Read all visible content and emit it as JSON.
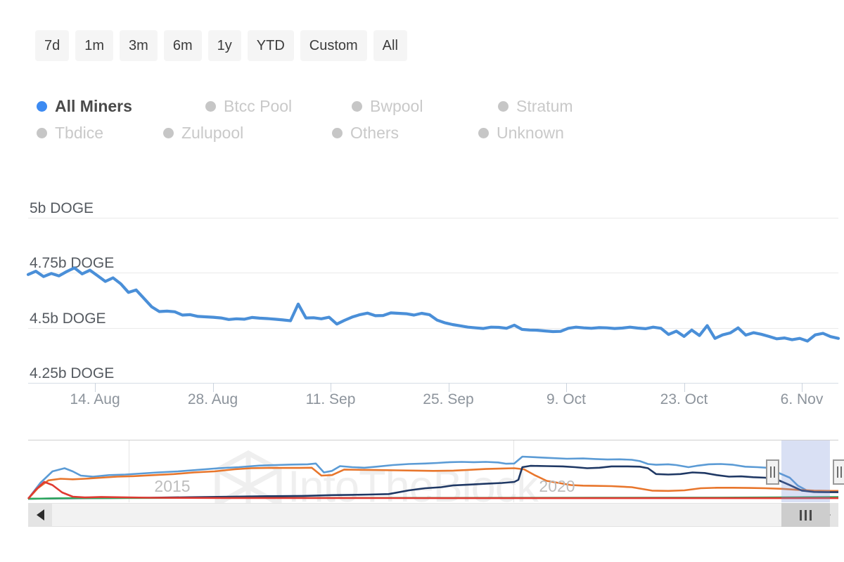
{
  "range_selector": {
    "buttons": [
      {
        "label": "7d",
        "selected": false
      },
      {
        "label": "1m",
        "selected": false
      },
      {
        "label": "3m",
        "selected": false
      },
      {
        "label": "6m",
        "selected": false
      },
      {
        "label": "1y",
        "selected": false
      },
      {
        "label": "YTD",
        "selected": false
      },
      {
        "label": "Custom",
        "selected": false
      },
      {
        "label": "All",
        "selected": false
      }
    ]
  },
  "legend": {
    "items": [
      {
        "label": "All Miners",
        "active": true,
        "color": "#3d8bf2"
      },
      {
        "label": "Btcc Pool",
        "active": false,
        "color": "#c6c6c6"
      },
      {
        "label": "Bwpool",
        "active": false,
        "color": "#c6c6c6"
      },
      {
        "label": "Stratum",
        "active": false,
        "color": "#c6c6c6"
      },
      {
        "label": "Tbdice",
        "active": false,
        "color": "#c6c6c6"
      },
      {
        "label": "Zulupool",
        "active": false,
        "color": "#c6c6c6"
      },
      {
        "label": "Others",
        "active": false,
        "color": "#c6c6c6"
      },
      {
        "label": "Unknown",
        "active": false,
        "color": "#c6c6c6"
      }
    ]
  },
  "watermark": {
    "text": "IntoTheBlock",
    "color": "#efefef"
  },
  "navigator": {
    "year_labels": [
      "2015",
      "2020"
    ],
    "selection_start_pct": 93.0,
    "selection_end_pct": 99.0,
    "series_colors": [
      "#5b9bd5",
      "#e8762c",
      "#1f3864",
      "#2eab5f",
      "#e03a32"
    ]
  },
  "scrollbar": {
    "left_arrow": "◀",
    "right_arrow": "▶",
    "thumb_start_pct": 93.0,
    "thumb_end_pct": 99.0
  },
  "chart_data": {
    "type": "line",
    "title": "",
    "xlabel": "",
    "ylabel": "DOGE",
    "ylim": [
      4.25,
      5.0
    ],
    "ytick_labels": [
      "5b DOGE",
      "4.75b DOGE",
      "4.5b DOGE",
      "4.25b DOGE"
    ],
    "ytick_values": [
      5.0,
      4.75,
      4.5,
      4.25
    ],
    "xtick_labels": [
      "14. Aug",
      "28. Aug",
      "11. Sep",
      "25. Sep",
      "9. Oct",
      "23. Oct",
      "6. Nov"
    ],
    "grid": true,
    "legend_position": "top",
    "line_color": "#4a8fd8",
    "series": [
      {
        "name": "All Miners",
        "unit": "b DOGE",
        "values": [
          4.742,
          4.757,
          4.733,
          4.747,
          4.736,
          4.756,
          4.772,
          4.745,
          4.762,
          4.737,
          4.711,
          4.727,
          4.7,
          4.661,
          4.672,
          4.634,
          4.596,
          4.574,
          4.576,
          4.573,
          4.558,
          4.56,
          4.552,
          4.55,
          4.548,
          4.545,
          4.538,
          4.541,
          4.539,
          4.547,
          4.544,
          4.542,
          4.539,
          4.536,
          4.532,
          4.608,
          4.545,
          4.546,
          4.541,
          4.548,
          4.517,
          4.534,
          4.549,
          4.56,
          4.567,
          4.555,
          4.556,
          4.568,
          4.566,
          4.564,
          4.558,
          4.566,
          4.56,
          4.535,
          4.523,
          4.515,
          4.509,
          4.503,
          4.5,
          4.497,
          4.503,
          4.502,
          4.498,
          4.512,
          4.493,
          4.49,
          4.489,
          4.486,
          4.483,
          4.484,
          4.498,
          4.503,
          4.5,
          4.498,
          4.501,
          4.5,
          4.497,
          4.499,
          4.503,
          4.499,
          4.496,
          4.503,
          4.498,
          4.47,
          4.485,
          4.461,
          4.49,
          4.465,
          4.51,
          4.452,
          4.468,
          4.477,
          4.5,
          4.467,
          4.478,
          4.471,
          4.461,
          4.45,
          4.454,
          4.446,
          4.452,
          4.44,
          4.468,
          4.475,
          4.46,
          4.452
        ]
      }
    ]
  }
}
